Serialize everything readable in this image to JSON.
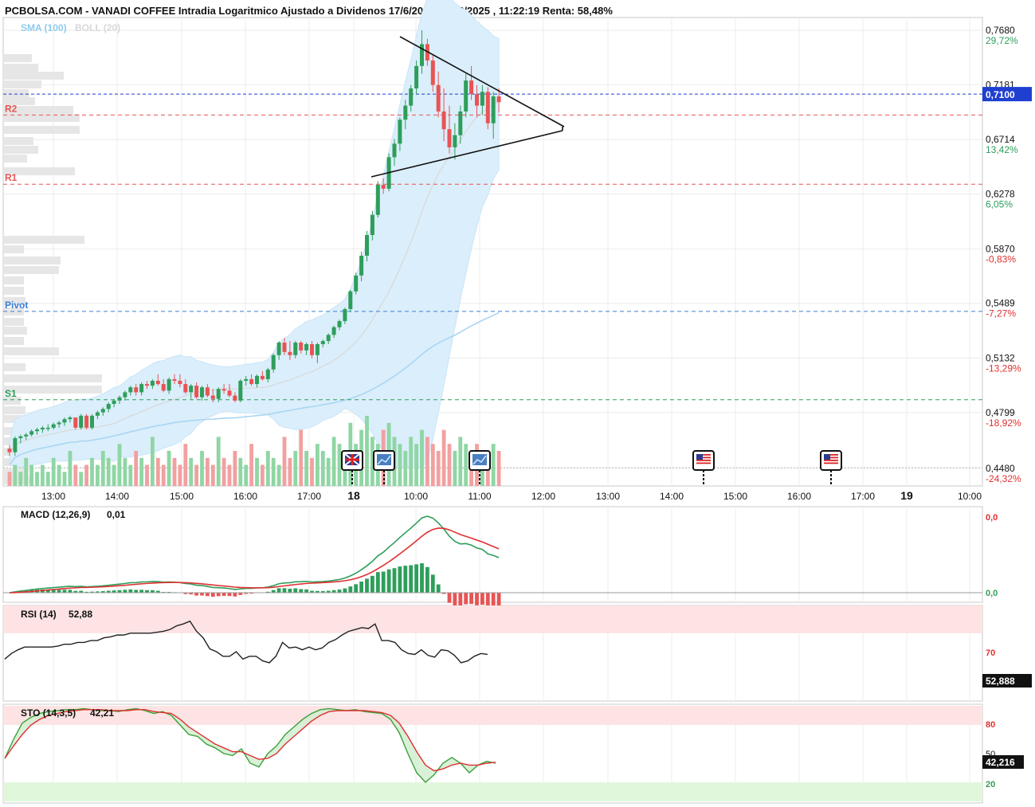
{
  "header": {
    "title": "PCBOLSA.COM - VANADI COFFEE Intradia Logaritmico Ajustado a Dividenos 17/6/2025 - 18/6/2025 , 11:22:19 Renta: 58,48%",
    "indicators_label_sma": "SMA (100)",
    "indicators_label_boll": "BOLL (20)"
  },
  "colors": {
    "up": "#2e9e5b",
    "down": "#e85454",
    "band_fill": "#dbeefb",
    "sma": "#a9d6f2",
    "resistance": "#e85454",
    "pivot": "#3b7dd8",
    "support": "#2e9e5b",
    "last_price_line": "#1f3fd1"
  },
  "chart_data": [
    {
      "type": "candlestick",
      "panel": "price",
      "scale": "log",
      "ylim": [
        0.448,
        0.768
      ],
      "y_ticks": [
        {
          "value": "0,7680",
          "pct": "29,72%"
        },
        {
          "value": "0,7181",
          "pct": "21,28%"
        },
        {
          "value": "0,6714",
          "pct": "13,42%"
        },
        {
          "value": "0,6278",
          "pct": "6,05%"
        },
        {
          "value": "0,5870",
          "pct": "-0,83%"
        },
        {
          "value": "0,5489",
          "pct": "-7,27%"
        },
        {
          "value": "0,5132",
          "pct": "-13,29%"
        },
        {
          "value": "0,4799",
          "pct": "-18,92%"
        },
        {
          "value": "0,4480",
          "pct": "-24,32%"
        }
      ],
      "x_ticks": [
        "13:00",
        "14:00",
        "15:00",
        "16:00",
        "17:00",
        "18",
        "10:00",
        "11:00",
        "12:00",
        "13:00",
        "14:00",
        "15:00",
        "16:00",
        "17:00",
        "19",
        "10:00"
      ],
      "last_price": {
        "value": 0.71,
        "label": "0,7100"
      },
      "levels": [
        {
          "name": "R2",
          "value": 0.692
        },
        {
          "name": "R1",
          "value": 0.6355
        },
        {
          "name": "Pivot",
          "value": 0.5435
        },
        {
          "name": "S1",
          "value": 0.4875
        }
      ],
      "candles": [
        [
          0.459,
          0.461,
          0.455,
          0.457
        ],
        [
          0.457,
          0.466,
          0.455,
          0.465
        ],
        [
          0.465,
          0.467,
          0.462,
          0.466
        ],
        [
          0.466,
          0.468,
          0.464,
          0.467
        ],
        [
          0.467,
          0.47,
          0.466,
          0.469
        ],
        [
          0.469,
          0.471,
          0.467,
          0.47
        ],
        [
          0.47,
          0.472,
          0.468,
          0.471
        ],
        [
          0.471,
          0.473,
          0.469,
          0.471
        ],
        [
          0.471,
          0.474,
          0.47,
          0.473
        ],
        [
          0.473,
          0.475,
          0.471,
          0.474
        ],
        [
          0.474,
          0.477,
          0.472,
          0.476
        ],
        [
          0.476,
          0.478,
          0.474,
          0.477
        ],
        [
          0.477,
          0.476,
          0.47,
          0.471
        ],
        [
          0.471,
          0.479,
          0.47,
          0.478
        ],
        [
          0.478,
          0.479,
          0.47,
          0.471
        ],
        [
          0.471,
          0.479,
          0.47,
          0.478
        ],
        [
          0.478,
          0.481,
          0.476,
          0.48
        ],
        [
          0.48,
          0.483,
          0.478,
          0.482
        ],
        [
          0.482,
          0.486,
          0.48,
          0.485
        ],
        [
          0.485,
          0.488,
          0.483,
          0.487
        ],
        [
          0.487,
          0.49,
          0.485,
          0.489
        ],
        [
          0.489,
          0.493,
          0.487,
          0.492
        ],
        [
          0.492,
          0.496,
          0.49,
          0.495
        ],
        [
          0.495,
          0.497,
          0.49,
          0.492
        ],
        [
          0.492,
          0.498,
          0.49,
          0.497
        ],
        [
          0.497,
          0.499,
          0.494,
          0.496
        ],
        [
          0.496,
          0.5,
          0.494,
          0.499
        ],
        [
          0.499,
          0.503,
          0.496,
          0.497
        ],
        [
          0.497,
          0.5,
          0.492,
          0.493
        ],
        [
          0.493,
          0.501,
          0.491,
          0.5
        ],
        [
          0.5,
          0.503,
          0.497,
          0.499
        ],
        [
          0.499,
          0.503,
          0.495,
          0.497
        ],
        [
          0.497,
          0.5,
          0.491,
          0.492
        ],
        [
          0.492,
          0.497,
          0.488,
          0.496
        ],
        [
          0.496,
          0.498,
          0.488,
          0.489
        ],
        [
          0.489,
          0.496,
          0.487,
          0.495
        ],
        [
          0.495,
          0.497,
          0.489,
          0.49
        ],
        [
          0.49,
          0.494,
          0.486,
          0.488
        ],
        [
          0.488,
          0.495,
          0.486,
          0.494
        ],
        [
          0.494,
          0.497,
          0.491,
          0.493
        ],
        [
          0.493,
          0.497,
          0.489,
          0.49
        ],
        [
          0.49,
          0.492,
          0.486,
          0.487
        ],
        [
          0.487,
          0.5,
          0.486,
          0.499
        ],
        [
          0.499,
          0.502,
          0.496,
          0.5
        ],
        [
          0.5,
          0.503,
          0.496,
          0.497
        ],
        [
          0.497,
          0.503,
          0.495,
          0.502
        ],
        [
          0.502,
          0.505,
          0.499,
          0.5
        ],
        [
          0.5,
          0.507,
          0.498,
          0.506
        ],
        [
          0.506,
          0.516,
          0.504,
          0.515
        ],
        [
          0.515,
          0.524,
          0.512,
          0.523
        ],
        [
          0.523,
          0.526,
          0.515,
          0.517
        ],
        [
          0.517,
          0.524,
          0.512,
          0.515
        ],
        [
          0.515,
          0.524,
          0.513,
          0.523
        ],
        [
          0.523,
          0.524,
          0.516,
          0.518
        ],
        [
          0.518,
          0.523,
          0.515,
          0.522
        ],
        [
          0.522,
          0.524,
          0.513,
          0.515
        ],
        [
          0.515,
          0.523,
          0.51,
          0.522
        ],
        [
          0.522,
          0.525,
          0.52,
          0.524
        ],
        [
          0.524,
          0.529,
          0.522,
          0.528
        ],
        [
          0.528,
          0.534,
          0.526,
          0.533
        ],
        [
          0.533,
          0.538,
          0.531,
          0.537
        ],
        [
          0.537,
          0.546,
          0.535,
          0.545
        ],
        [
          0.545,
          0.558,
          0.543,
          0.557
        ],
        [
          0.557,
          0.57,
          0.555,
          0.568
        ],
        [
          0.568,
          0.585,
          0.564,
          0.582
        ],
        [
          0.582,
          0.6,
          0.578,
          0.597
        ],
        [
          0.597,
          0.615,
          0.593,
          0.612
        ],
        [
          0.612,
          0.638,
          0.61,
          0.635
        ],
        [
          0.635,
          0.64,
          0.628,
          0.632
        ],
        [
          0.632,
          0.66,
          0.63,
          0.657
        ],
        [
          0.657,
          0.672,
          0.65,
          0.668
        ],
        [
          0.668,
          0.69,
          0.662,
          0.688
        ],
        [
          0.688,
          0.705,
          0.68,
          0.7
        ],
        [
          0.7,
          0.718,
          0.695,
          0.715
        ],
        [
          0.715,
          0.74,
          0.71,
          0.735
        ],
        [
          0.735,
          0.768,
          0.728,
          0.755
        ],
        [
          0.755,
          0.76,
          0.735,
          0.74
        ],
        [
          0.74,
          0.745,
          0.712,
          0.718
        ],
        [
          0.718,
          0.73,
          0.69,
          0.695
        ],
        [
          0.695,
          0.715,
          0.67,
          0.68
        ],
        [
          0.68,
          0.7,
          0.66,
          0.665
        ],
        [
          0.665,
          0.685,
          0.655,
          0.675
        ],
        [
          0.675,
          0.7,
          0.668,
          0.695
        ],
        [
          0.695,
          0.728,
          0.69,
          0.722
        ],
        [
          0.722,
          0.735,
          0.705,
          0.71
        ],
        [
          0.71,
          0.718,
          0.69,
          0.7
        ],
        [
          0.7,
          0.718,
          0.692,
          0.712
        ],
        [
          0.712,
          0.716,
          0.68,
          0.685
        ],
        [
          0.685,
          0.712,
          0.672,
          0.708
        ],
        [
          0.708,
          0.715,
          0.694,
          0.703
        ]
      ],
      "volume": [
        0.2,
        0.3,
        0.2,
        0.4,
        0.3,
        0.2,
        0.3,
        0.2,
        0.4,
        0.3,
        0.2,
        0.5,
        0.3,
        0.2,
        0.3,
        0.4,
        0.3,
        0.5,
        0.4,
        0.3,
        0.6,
        0.4,
        0.3,
        0.5,
        0.4,
        0.3,
        0.7,
        0.4,
        0.3,
        0.5,
        0.4,
        0.3,
        0.6,
        0.4,
        0.3,
        0.5,
        0.4,
        0.3,
        0.7,
        0.4,
        0.3,
        0.5,
        0.4,
        0.3,
        0.6,
        0.4,
        0.3,
        0.5,
        0.4,
        0.3,
        0.7,
        0.4,
        0.5,
        0.8,
        0.5,
        0.4,
        0.6,
        0.5,
        0.4,
        0.7,
        0.6,
        0.5,
        0.9,
        0.6,
        0.8,
        1.0,
        0.7,
        0.6,
        0.8,
        0.9,
        0.7,
        0.6,
        0.5,
        0.7,
        0.6,
        0.8,
        0.7,
        0.6,
        0.5,
        0.8,
        0.6,
        0.5,
        0.7,
        0.6,
        0.5,
        0.6,
        0.5,
        0.4,
        0.6,
        0.5
      ]
    },
    {
      "type": "line",
      "panel": "macd",
      "title": "MACD (12,26,9)",
      "value": "0,01",
      "y_ticks": [
        "0,0",
        "0,0"
      ]
    },
    {
      "type": "line",
      "panel": "rsi",
      "title": "RSI (14)",
      "value": "52,88",
      "last_label": "52,888",
      "ylim": [
        0,
        100
      ],
      "y_ticks": [
        "70"
      ],
      "values": [
        42,
        48,
        52,
        55,
        55,
        55,
        55,
        55,
        56,
        58,
        58,
        60,
        60,
        62,
        62,
        65,
        66,
        68,
        68,
        70,
        70,
        70,
        70,
        71,
        72,
        74,
        78,
        80,
        83,
        72,
        65,
        53,
        50,
        45,
        45,
        50,
        42,
        45,
        45,
        40,
        38,
        45,
        60,
        54,
        55,
        52,
        55,
        52,
        54,
        60,
        63,
        68,
        72,
        74,
        76,
        75,
        80,
        62,
        62,
        60,
        52,
        48,
        47,
        52,
        46,
        44,
        52,
        51,
        46,
        38,
        40,
        45,
        48,
        47
      ]
    },
    {
      "type": "line",
      "panel": "sto",
      "title": "STO (14,3,5)",
      "value": "42,21",
      "last_label": "42,216",
      "ylim": [
        0,
        100
      ],
      "y_ticks": [
        "80",
        "50",
        "20"
      ],
      "k": [
        45,
        65,
        82,
        88,
        92,
        94,
        95,
        96,
        96,
        97,
        96,
        95,
        95,
        94,
        96,
        97,
        95,
        92,
        94,
        90,
        80,
        70,
        68,
        60,
        56,
        50,
        48,
        55,
        40,
        36,
        50,
        58,
        70,
        78,
        86,
        92,
        96,
        97,
        96,
        95,
        96,
        94,
        93,
        92,
        86,
        72,
        50,
        30,
        20,
        28,
        40,
        46,
        40,
        30,
        38,
        42,
        40
      ],
      "d": [
        45,
        58,
        70,
        80,
        86,
        90,
        92,
        94,
        95,
        96,
        96,
        96,
        95,
        95,
        95,
        96,
        96,
        94,
        93,
        92,
        86,
        78,
        72,
        66,
        60,
        56,
        52,
        52,
        48,
        44,
        45,
        50,
        60,
        68,
        76,
        84,
        90,
        94,
        95,
        95,
        95,
        95,
        94,
        93,
        90,
        82,
        68,
        52,
        38,
        32,
        34,
        38,
        40,
        38,
        38,
        40,
        41
      ]
    }
  ]
}
